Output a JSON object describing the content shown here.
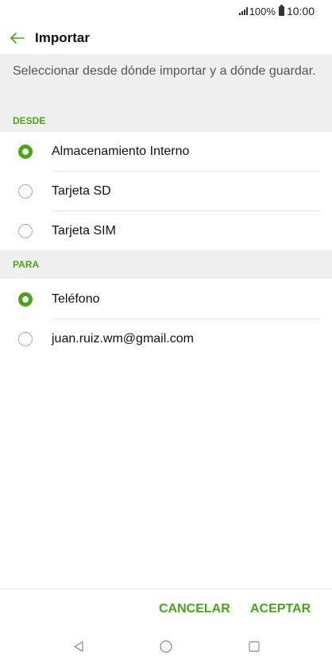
{
  "status_bar": {
    "battery": "100%",
    "time": "10:00"
  },
  "app_bar": {
    "title": "Importar"
  },
  "description": "Seleccionar desde dónde importar y a dónde guardar.",
  "from_section": {
    "header": "DESDE",
    "options": [
      {
        "label": "Almacenamiento Interno",
        "selected": true
      },
      {
        "label": "Tarjeta SD",
        "selected": false
      },
      {
        "label": "Tarjeta SIM",
        "selected": false
      }
    ]
  },
  "to_section": {
    "header": "PARA",
    "options": [
      {
        "label": "Teléfono",
        "selected": true
      },
      {
        "label": "juan.ruiz.wm@gmail.com",
        "selected": false
      }
    ]
  },
  "actions": {
    "cancel_label": "CANCELAR",
    "accept_label": "ACEPTAR"
  },
  "colors": {
    "accent": "#4aa516",
    "section_bg": "#efefef"
  },
  "icons": {
    "back": "arrow-left-icon",
    "nav_back": "triangle-back-icon",
    "nav_home": "circle-home-icon",
    "nav_recents": "square-recents-icon"
  }
}
